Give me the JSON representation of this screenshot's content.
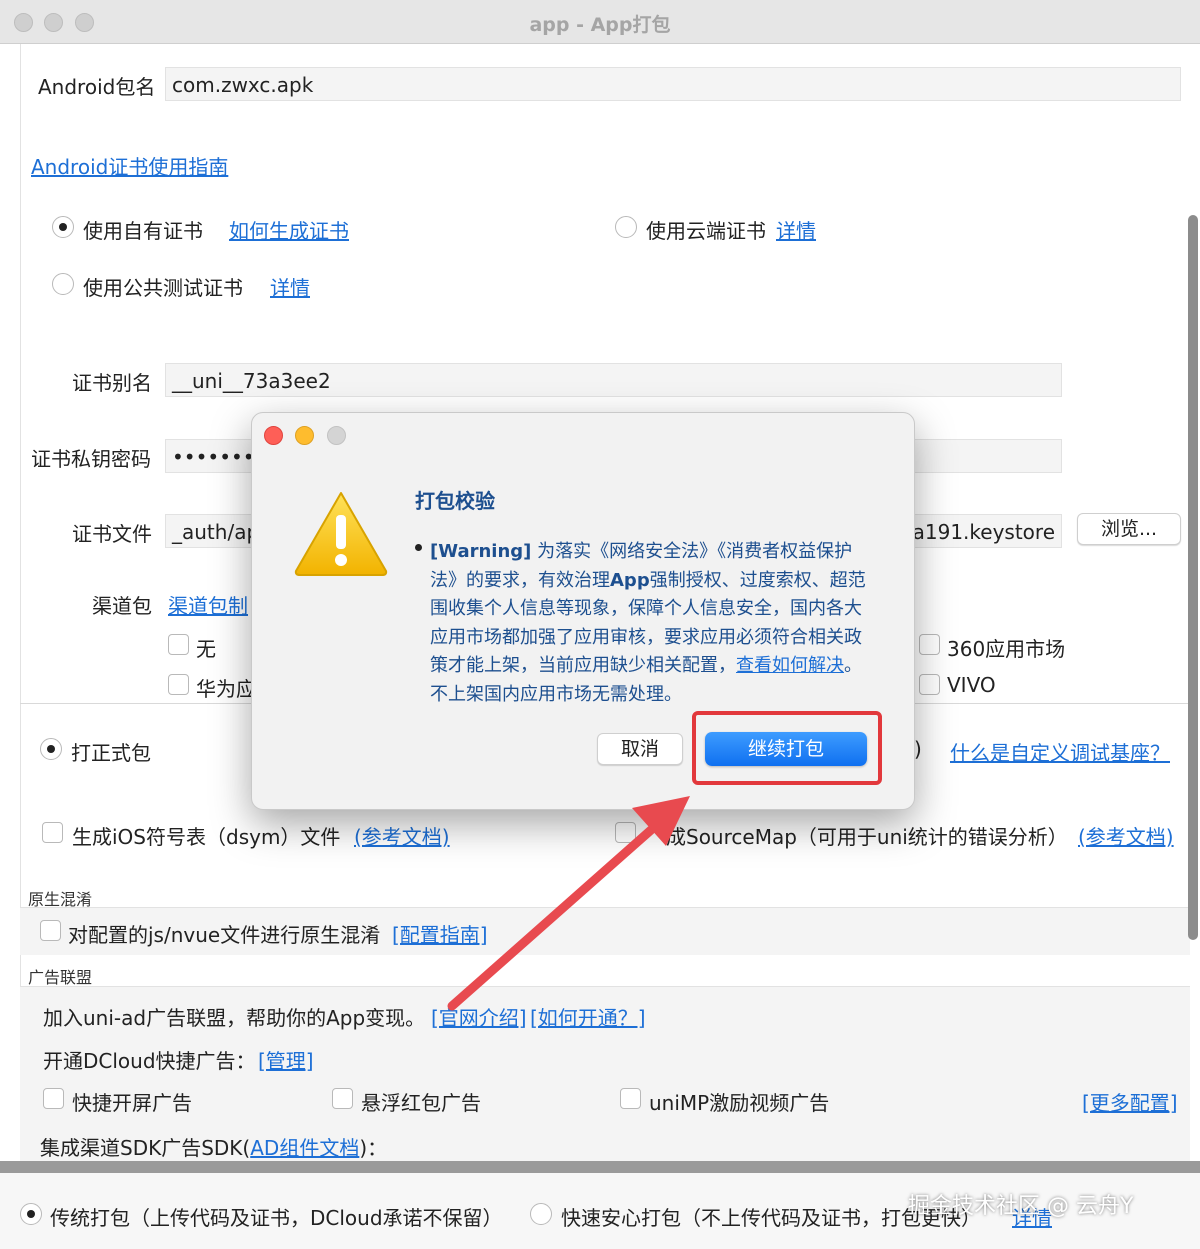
{
  "window": {
    "title": "app - App打包"
  },
  "android": {
    "package_label": "Android包名",
    "package_value": "com.zwxc.apk",
    "cert_guide_link": "Android证书使用指南",
    "own_cert": "使用自有证书",
    "how_generate_link": "如何生成证书",
    "cloud_cert": "使用云端证书",
    "details_link": "详情",
    "public_cert": "使用公共测试证书",
    "alias_label": "证书别名",
    "alias_value": "__uni__73a3ee2",
    "password_label": "证书私钥密码",
    "password_value": "••••••••",
    "file_label": "证书文件",
    "file_value_left": "_auth/app",
    "file_value_right": "bfa191.keystore",
    "browse_button": "浏览...",
    "channel_label": "渠道包",
    "channel_link": "渠道包制",
    "channel_none": "无",
    "channel_huawei": "华为应",
    "channel_360": "360应用市场",
    "channel_vivo": "VIVO"
  },
  "build": {
    "formal_pack": "打正式包",
    "custom_base_suffix": ")",
    "custom_base_link": "什么是自定义调试基座？",
    "dsym_label": "生成iOS符号表（dsym）文件",
    "ref_doc_link": "(参考文档)",
    "sourcemap_label": "成SourceMap（可用于uni统计的错误分析）",
    "ref_doc_link2": "(参考文档)"
  },
  "obfuscation": {
    "section_title": "原生混淆",
    "label": "对配置的js/nvue文件进行原生混淆",
    "guide_link": "[配置指南]"
  },
  "ads": {
    "section_title": "广告联盟",
    "intro": "加入uni-ad广告联盟，帮助你的App变现。",
    "official_link": "[官网介绍]",
    "how_open_link": "[如何开通？]",
    "quick_ad_label": "开通DCloud快捷广告：",
    "manage_link": "[管理]",
    "splash_ad": "快捷开屏广告",
    "float_ad": "悬浮红包广告",
    "video_ad": "uniMP激励视频广告",
    "more_config_link": "[更多配置]",
    "sdk_label_pre": "集成渠道SDK广告SDK(",
    "sdk_link": "AD组件文档",
    "sdk_label_post": ")："
  },
  "footer": {
    "traditional": "传统打包（上传代码及证书，DCloud承诺不保留）",
    "fast": "快速安心打包（不上传代码及证书，打包更快）",
    "details": "详情"
  },
  "dialog": {
    "title": "打包校验",
    "warning_tag": "[Warning]",
    "warning_text_1": "为落实《网络安全法》《消费者权益保护法》的要求，有效治理",
    "warning_bold": "App",
    "warning_text_2": "强制授权、过度索权、超范围收集个人信息等现象，保障个人信息安全，国内各大应用市场都加强了应用审核，要求应用必须符合相关政策才能上架，当前应用缺少相关配置，",
    "warning_link": "查看如何解决",
    "warning_text_3": "。不上架国内应用市场无需处理。",
    "cancel_button": "取消",
    "continue_button": "继续打包"
  },
  "watermark": "掘金技术社区 @ 云舟Y",
  "colors": {
    "accent": "#1d6fd6",
    "highlight": "#e2383c",
    "arrow": "#e84a4f",
    "primary": "#1a7ff7"
  },
  "icons": [
    "warning-triangle-icon",
    "arrow-annotation-icon"
  ]
}
